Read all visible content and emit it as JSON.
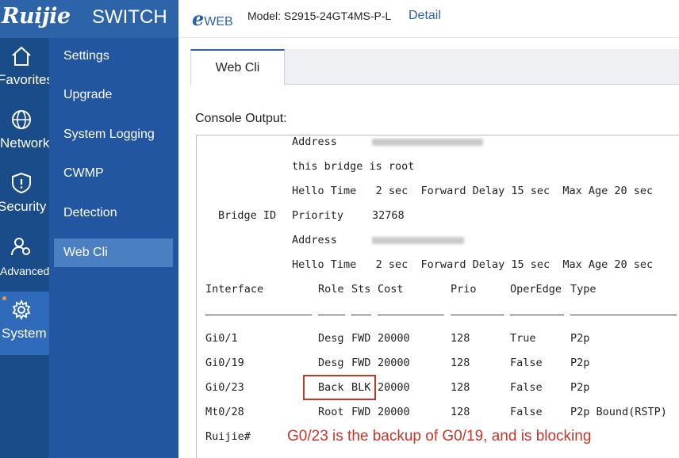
{
  "brand": {
    "logo": "Ruijie",
    "product": "SWITCH"
  },
  "header": {
    "logo_e": "e",
    "logo_web": "WEB",
    "model": "Model: S2915-24GT4MS-P-L",
    "detail_link": "Detail"
  },
  "rail": [
    {
      "label": "Favorites",
      "icon": "home-icon"
    },
    {
      "label": "Network",
      "icon": "globe-icon"
    },
    {
      "label": "Security",
      "icon": "shield-icon"
    },
    {
      "label": "Advanced",
      "icon": "users-gear-icon"
    },
    {
      "label": "System",
      "icon": "gear-icon",
      "active": true
    }
  ],
  "submenu": [
    "Settings",
    "Upgrade",
    "System Logging",
    "CWMP",
    "Detection",
    "Web Cli"
  ],
  "submenu_active": "Web Cli",
  "tab": "Web Cli",
  "console_label": "Console Output:",
  "console": {
    "root_block": {
      "address_label": "Address",
      "root_text": "this bridge is root",
      "hello_line": "Hello Time   2 sec  Forward Delay 15 sec  Max Age 20 sec"
    },
    "bridge_block": {
      "bridge_id_label": "Bridge ID",
      "priority_label": "Priority",
      "priority_value": "32768",
      "address_label": "Address",
      "hello_line": "Hello Time   2 sec  Forward Delay 15 sec  Max Age 20 sec"
    },
    "columns": [
      "Interface",
      "Role",
      "Sts",
      "Cost",
      "Prio",
      "OperEdge",
      "Type"
    ],
    "rows": [
      {
        "interface": "Gi0/1",
        "role": "Desg",
        "sts": "FWD",
        "cost": "20000",
        "prio": "128",
        "operedge": "True",
        "type": "P2p"
      },
      {
        "interface": "Gi0/19",
        "role": "Desg",
        "sts": "FWD",
        "cost": "20000",
        "prio": "128",
        "operedge": "False",
        "type": "P2p"
      },
      {
        "interface": "Gi0/23",
        "role": "Back",
        "sts": "BLK",
        "cost": "20000",
        "prio": "128",
        "operedge": "False",
        "type": "P2p"
      },
      {
        "interface": "Mt0/28",
        "role": "Root",
        "sts": "FWD",
        "cost": "20000",
        "prio": "128",
        "operedge": "False",
        "type": "P2p Bound(RSTP)"
      }
    ],
    "prompt": "Ruijie#"
  },
  "annotation": "G0/23 is the backup of G0/19, and is blocking",
  "colors": {
    "brand_blue": "#2d64a9",
    "rail_bg": "#1b4c8a",
    "submenu_bg": "#2356a0",
    "annotation_red": "#c8352a",
    "notify_dot": "#f39b3c"
  }
}
